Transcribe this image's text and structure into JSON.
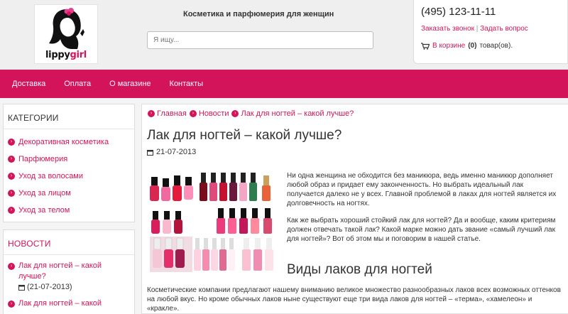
{
  "header": {
    "logo_text_dark": "lippy",
    "logo_text_accent": "girl",
    "tagline": "Косметика и парфюмерия для женщин",
    "search_placeholder": "Я ищу...",
    "phone": "(495) 123-11-11",
    "callback_link": "Заказать звонок",
    "link_separator": "|",
    "question_link": "Задать вопрос",
    "cart_prefix": "В корзине",
    "cart_count": "(0)",
    "cart_suffix": "товар(ов)."
  },
  "nav": {
    "items": [
      "Доставка",
      "Оплата",
      "О магазине",
      "Контакты"
    ]
  },
  "sidebar": {
    "categories_title": "КАТЕГОРИИ",
    "categories": [
      "Декоративная косметика",
      "Парфюмерия",
      "Уход за волосами",
      "Уход за лицом",
      "Уход за телом"
    ],
    "news_title": "НОВОСТИ",
    "news": [
      {
        "title": "Лак для ногтей – какой лучше?",
        "date": "(21-07-2013)"
      },
      {
        "title": "Лак для ногтей – какой"
      }
    ]
  },
  "breadcrumb": [
    "Главная",
    "Новости",
    "Лак для ногтей – какой лучше?"
  ],
  "article": {
    "title": "Лак для ногтей – какой лучше?",
    "date": "21-07-2013",
    "p1": "Ни одна женщина не обходится без маникюра, ведь именно маникюр дополняет любой образ и придает ему законченность. Но выбрать идеальный лак получается далеко не у всех. Главной проблемой в лаках для ногтей является их долговечность на ногтях.",
    "p2": "Как же выбрать хороший стойкий лак для ногтей? Да и вообще, каким критериям должен отвечать такой лак? Какой марке можно дать звание «самый лучший лак для ногтей»? Вот об этом мы и поговорим в нашей статье.",
    "h2": "Виды лаков для ногтей",
    "p3": "Косметические компании предлагают нашему вниманию великое множество разнообразных лаков всех возможных оттенков на любой вкус. Но кроме обычных лаков ныне существуют еще три вида лаков для ногтей – «терма», «хамелеон» и «кракле»."
  },
  "colors": {
    "accent": "#d4145a",
    "header_bg": "#efefef",
    "page_bg": "#f4f4f4"
  }
}
